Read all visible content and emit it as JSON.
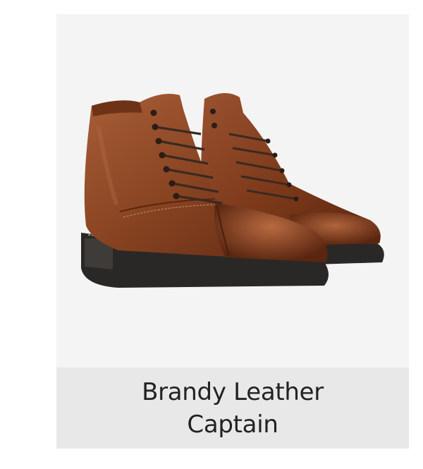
{
  "product": {
    "name": "Brandy Leather Captain",
    "image_icon": "leather-boot-icon"
  },
  "colors": {
    "card_background": "#f4f4f4",
    "caption_background": "#e8e8e8",
    "title_text": "#222222",
    "leather": "#8a4522",
    "sole": "#2a2826"
  }
}
